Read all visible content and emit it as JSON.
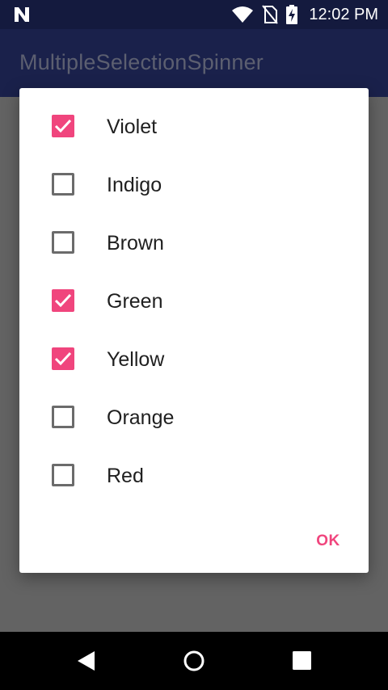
{
  "status_bar": {
    "time": "12:02 PM",
    "icons": [
      "n-notification-icon",
      "wifi-icon",
      "no-sim-icon",
      "battery-charging-icon"
    ]
  },
  "app_bar": {
    "title": "MultipleSelectionSpinner"
  },
  "dialog": {
    "options": [
      {
        "label": "Violet",
        "checked": true
      },
      {
        "label": "Indigo",
        "checked": false
      },
      {
        "label": "Brown",
        "checked": false
      },
      {
        "label": "Green",
        "checked": true
      },
      {
        "label": "Yellow",
        "checked": true
      },
      {
        "label": "Orange",
        "checked": false
      },
      {
        "label": "Red",
        "checked": false
      }
    ],
    "ok_label": "OK"
  },
  "nav_bar": {
    "icons": [
      "back-icon",
      "home-icon",
      "recents-icon"
    ]
  },
  "colors": {
    "accent": "#f0457d",
    "status_bar": "#141a3e",
    "app_bar": "#1a214b",
    "scrim": "#636363"
  }
}
